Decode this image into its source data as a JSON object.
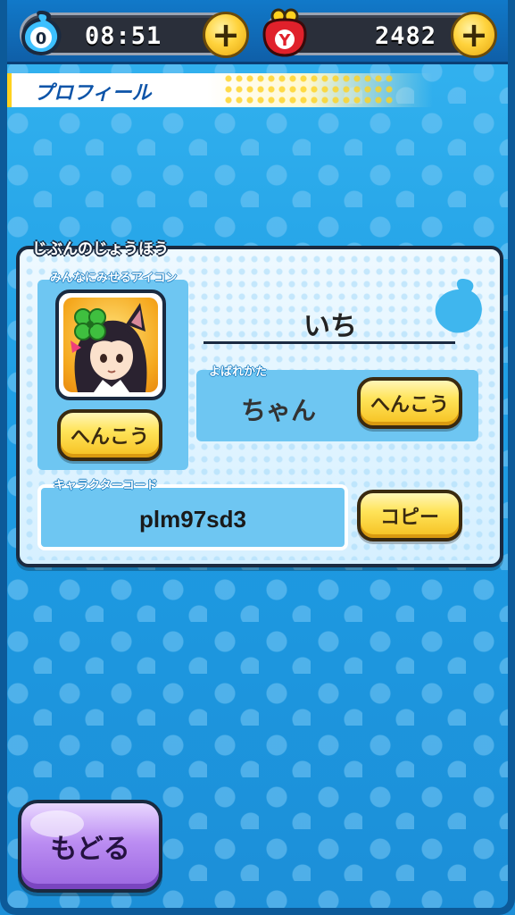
{
  "status_bar": {
    "spirit_count": "0",
    "time": "08:51",
    "money_icon_letter": "Y",
    "money": "2482",
    "plus": "+"
  },
  "header": {
    "title": "プロフィール"
  },
  "profile_card": {
    "section_label": "じぶんのじょうほう",
    "icon_panel_label": "みんなにみせるアイコン",
    "icon_change_button": "へんこう",
    "player_name": "いち",
    "honorific_label": "よばれかた",
    "honorific_value": "ちゃん",
    "honorific_change_button": "へんこう",
    "character_code_label": "キャラクターコード",
    "character_code": "plm97sd3",
    "copy_button": "コピー"
  },
  "footer": {
    "back_button": "もどる"
  },
  "colors": {
    "background_blue": "#1f9fe6",
    "yellow_button": "#ffe45a",
    "purple_button": "#bb8df2",
    "header_text": "#0d54a8"
  },
  "icons": [
    "water-drop-icon",
    "yen-purse-icon",
    "plus-icon",
    "avatar-portrait",
    "water-drop-deco-icon"
  ]
}
